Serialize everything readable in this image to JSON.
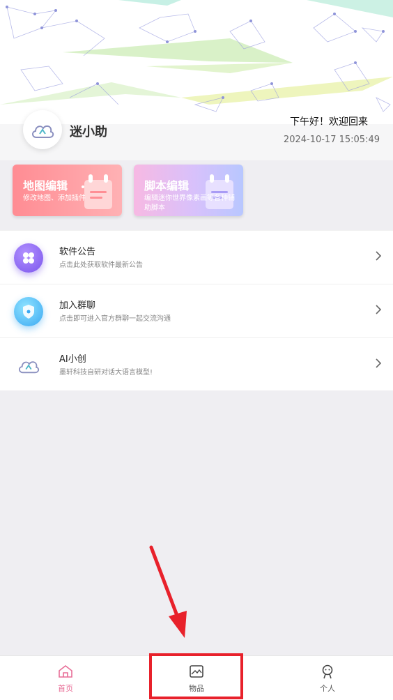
{
  "header": {
    "app_name": "迷小助",
    "greeting": "下午好！欢迎回来",
    "datetime": "2024-10-17 15:05:49"
  },
  "cards": [
    {
      "title": "地图编辑",
      "subtitle": "修改地图、添加插件"
    },
    {
      "title": "脚本编辑",
      "subtitle": "编辑迷你世界像素画等各种辅助脚本"
    }
  ],
  "menu": {
    "items": [
      {
        "title": "软件公告",
        "subtitle": "点击此处获取软件最新公告",
        "icon": "clover-icon"
      },
      {
        "title": "加入群聊",
        "subtitle": "点击即可进入官方群聊一起交流沟通",
        "icon": "shield-icon"
      },
      {
        "title": "AI小创",
        "subtitle": "墨轩科技自研对话大语言模型!",
        "icon": "cloud-icon"
      }
    ]
  },
  "tabbar": {
    "tabs": [
      {
        "label": "首页",
        "icon": "home-icon",
        "active": true
      },
      {
        "label": "物品",
        "icon": "image-icon",
        "active": false
      },
      {
        "label": "个人",
        "icon": "person-icon",
        "active": false
      }
    ]
  },
  "colors": {
    "accent": "#e86e97",
    "annotation": "#e8212b",
    "map_card": "#ff8c93",
    "script_card": "#d8c1fb"
  }
}
